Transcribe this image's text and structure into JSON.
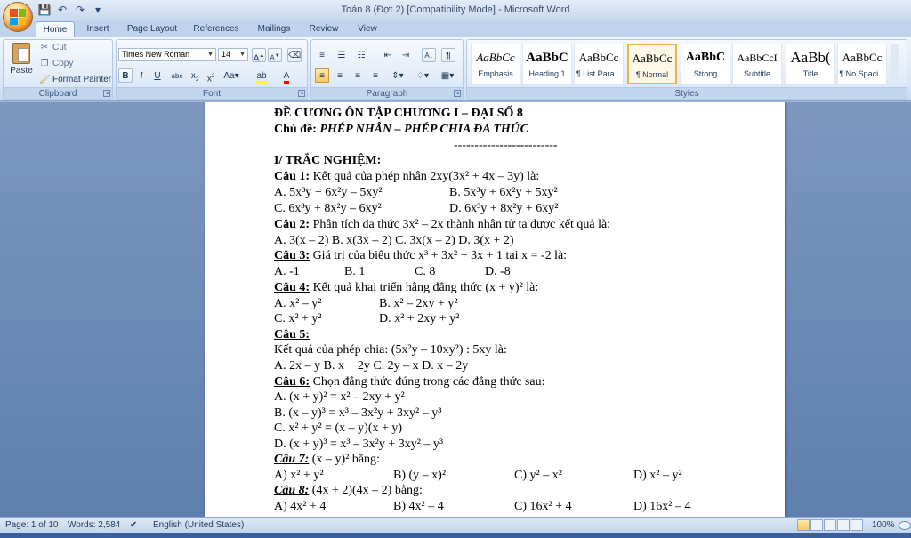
{
  "window": {
    "title": "Toán 8 (Đợt 2) [Compatibility Mode] - Microsoft Word"
  },
  "tabs": [
    "Home",
    "Insert",
    "Page Layout",
    "References",
    "Mailings",
    "Review",
    "View"
  ],
  "clipboard": {
    "paste": "Paste",
    "cut": "Cut",
    "copy": "Copy",
    "format_painter": "Format Painter",
    "group_label": "Clipboard"
  },
  "font": {
    "family": "Times New Roman",
    "size": "14",
    "group_label": "Font"
  },
  "paragraph": {
    "group_label": "Paragraph"
  },
  "styles": {
    "group_label": "Styles",
    "items": [
      {
        "sample": "AaBbCc",
        "name": "Emphasis"
      },
      {
        "sample": "AaBbC",
        "name": "Heading 1"
      },
      {
        "sample": "AaBbCc",
        "name": "¶ List Para..."
      },
      {
        "sample": "AaBbCc",
        "name": "¶ Normal"
      },
      {
        "sample": "AaBbC",
        "name": "Strong"
      },
      {
        "sample": "AaBbCcI",
        "name": "Subtitle"
      },
      {
        "sample": "AaBb(",
        "name": "Title"
      },
      {
        "sample": "AaBbCc",
        "name": "¶ No Spaci..."
      }
    ]
  },
  "status": {
    "page": "Page: 1 of 10",
    "words": "Words: 2,584",
    "language": "English (United States)",
    "zoom": "100%"
  },
  "doc": {
    "title": "ĐỀ CƯƠNG ÔN TẬP CHƯƠNG I – ĐẠI SỐ 8",
    "topic_label": "Chủ đề",
    "topic": "PHÉP NHÂN – PHÉP CHIA ĐA THỨC",
    "divider": "-------------------------",
    "section": "I/ TRẮC NGHIỆM:",
    "q1_label": "Câu 1:",
    "q1_text": " Kết quả của phép nhân 2xy(3x² + 4x – 3y) là:",
    "q1_a": "A. 5x³y + 6x²y – 5xy²",
    "q1_b": "B. 5x³y + 6x²y + 5xy²",
    "q1_c": "C. 6x³y + 8x²y – 6xy²",
    "q1_d": "D. 6x³y + 8x²y + 6xy²",
    "q2_label": "Câu 2:",
    "q2_text": " Phân tích đa thức 3x² – 2x thành nhân tử ta được kết quả là:",
    "q2_opts": "A. 3(x – 2)   B. x(3x – 2)  C. 3x(x – 2)  D. 3(x + 2)",
    "q3_label": "Câu 3:",
    "q3_text": " Giá trị của biểu thức x³ + 3x² + 3x + 1 tại x = -2 là:",
    "q3_a": "A. -1",
    "q3_b": "B. 1",
    "q3_c": "C. 8",
    "q3_d": "D. -8",
    "q4_label": "Câu 4:",
    "q4_text": " Kết quả khai triển hằng đẳng thức (x + y)² là:",
    "q4_a": "A. x² – y²",
    "q4_b": "B. x² – 2xy + y²",
    "q4_c": "C. x² + y²",
    "q4_d": "D. x² + 2xy + y²",
    "q5_label": "Câu 5:",
    "q5_text": "Kết quả của phép chia: (5x²y – 10xy²) : 5xy là:",
    "q5_opts": "A. 2x – y    B. x + 2y    C. 2y – x    D. x – 2y",
    "q6_label": "Câu 6:",
    "q6_text": " Chọn đẳng thức đúng trong các đẳng thức sau:",
    "q6_a": "A. (x + y)² = x² – 2xy + y²",
    "q6_b": "B. (x – y)³ = x³ – 3x²y + 3xy² – y³",
    "q6_c": "C. x² + y² = (x – y)(x + y)",
    "q6_d": "D. (x + y)³ = x³ – 3x²y + 3xy² – y³",
    "q7_label": "Câu 7:",
    "q7_text": "  (x – y)²  bằng:",
    "q7_a": "A)  x² + y²",
    "q7_b": "B)  (y – x)²",
    "q7_c": "C)  y² – x²",
    "q7_d": "D)  x² – y²",
    "q8_label": "Câu 8:",
    "q8_text": "  (4x + 2)(4x – 2)  bằng:",
    "q8_a": "A)   4x² + 4",
    "q8_b": "B)   4x² – 4",
    "q8_c": "C)  16x² + 4",
    "q8_d": "D)   16x² – 4"
  }
}
